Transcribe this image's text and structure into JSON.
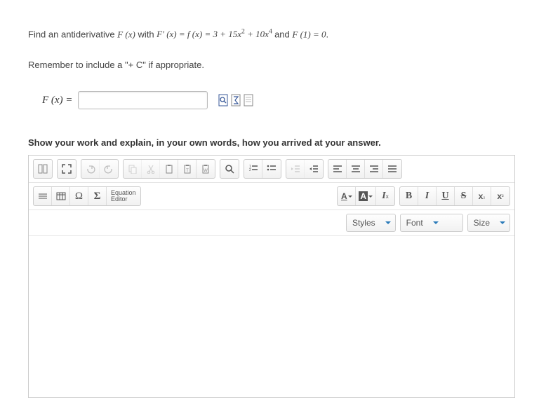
{
  "problem": {
    "prefix": "Find an antiderivative ",
    "Fx": "F (x)",
    "with": " with ",
    "Fprime": "F′ (x) = f (x) = 3 + 15x",
    "exp1": "2",
    "plus": " + 10x",
    "exp2": "4",
    "and": " and ",
    "cond": "F (1) = 0",
    "dot": "."
  },
  "hint": "Remember to include a \"+ C\" if appropriate.",
  "answer_label": "F (x) =",
  "answer_value": "",
  "work_prompt": "Show your work and explain, in your own words, how you arrived at your answer.",
  "toolbar": {
    "equation_editor": "Equation\nEditor",
    "styles": "Styles",
    "font": "Font",
    "size": "Size"
  },
  "icons": {
    "preview": "preview-icon",
    "sigma": "sigma-icon",
    "page": "page-icon"
  }
}
